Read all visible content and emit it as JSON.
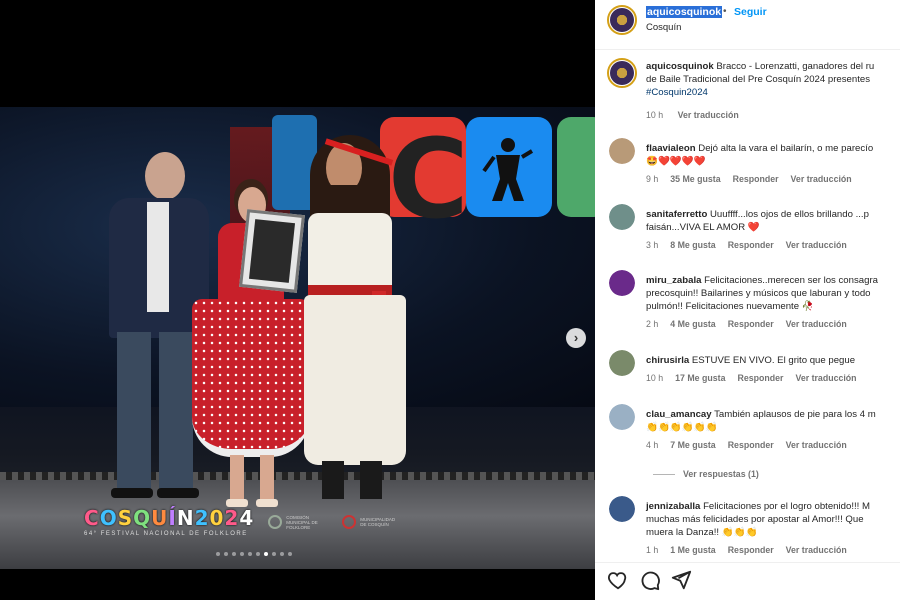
{
  "post": {
    "username": "aquicosquinok",
    "follow_label": "Seguir",
    "separator": "•",
    "location": "Cosquín",
    "caption_lines": [
      "Bracco - Lorenzatti, ganadores del ru",
      "de Baile Tradicional del Pre Cosquín 2024 presentes",
      "#Cosquin2024"
    ],
    "caption_time": "10 h",
    "caption_translate": "Ver traducción"
  },
  "media": {
    "logo_text": "COSQUÍN2024",
    "logo_subtitle": "64° FESTIVAL NACIONAL DE FOLKLORE",
    "sponsor1": "COMISIÓN MUNICIPAL DE FOLKLORE",
    "sponsor2": "MUNICIPALIDAD DE COSQUÍN",
    "next_icon": "chevron-right-icon",
    "carousel_count": 10,
    "carousel_active": 6
  },
  "comments": [
    {
      "user": "flaavialeon",
      "text": "Dejó alta la vara el bailarín, o me parecío",
      "line2": "🤩❤️❤️❤️❤️",
      "time": "9 h",
      "likes": "35 Me gusta",
      "reply": "Responder",
      "translate": "Ver traducción",
      "avatar_color": "#b89a78"
    },
    {
      "user": "sanitaferretto",
      "text": "Uuuffff...los ojos de ellos brillando ...p",
      "line2": "faisán...VIVA EL AMOR ❤️",
      "time": "3 h",
      "likes": "8 Me gusta",
      "reply": "Responder",
      "translate": "Ver traducción",
      "avatar_color": "#6f8f8a"
    },
    {
      "user": "miru_zabala",
      "text": "Felicitaciones..merecen ser los consagra",
      "line2": "precosquin!! Bailarines y músicos que laburan y todo",
      "line3": "pulmón!! Felicitaciones nuevamente 🥀",
      "time": "2 h",
      "likes": "4 Me gusta",
      "reply": "Responder",
      "translate": "Ver traducción",
      "avatar_color": "#6a2a8a"
    },
    {
      "user": "chirusirla",
      "text": "ESTUVE EN VIVO. El grito que pegue",
      "time": "10 h",
      "likes": "17 Me gusta",
      "reply": "Responder",
      "translate": "Ver traducción",
      "avatar_color": "#7a8a6a"
    },
    {
      "user": "clau_amancay",
      "text": "También aplausos de pie para los 4 m",
      "line2": "👏👏👏👏👏👏",
      "time": "4 h",
      "likes": "7 Me gusta",
      "reply": "Responder",
      "translate": "Ver traducción",
      "avatar_color": "#9ab0c4"
    },
    {
      "user": "jennizaballa",
      "text": "Felicitaciones por el logro obtenido!!! M",
      "line2": "muchas más felicidades por apostar al Amor!!! Que",
      "line3": "muera la Danza!! 👏👏👏",
      "time": "1 h",
      "likes": "1 Me gusta",
      "reply": "Responder",
      "translate": "Ver traducción",
      "avatar_color": "#3a5a8a"
    }
  ],
  "view_replies": "Ver respuestas (1)",
  "actions": {
    "like_icon": "heart-icon",
    "comment_icon": "comment-icon",
    "share_icon": "share-icon"
  }
}
